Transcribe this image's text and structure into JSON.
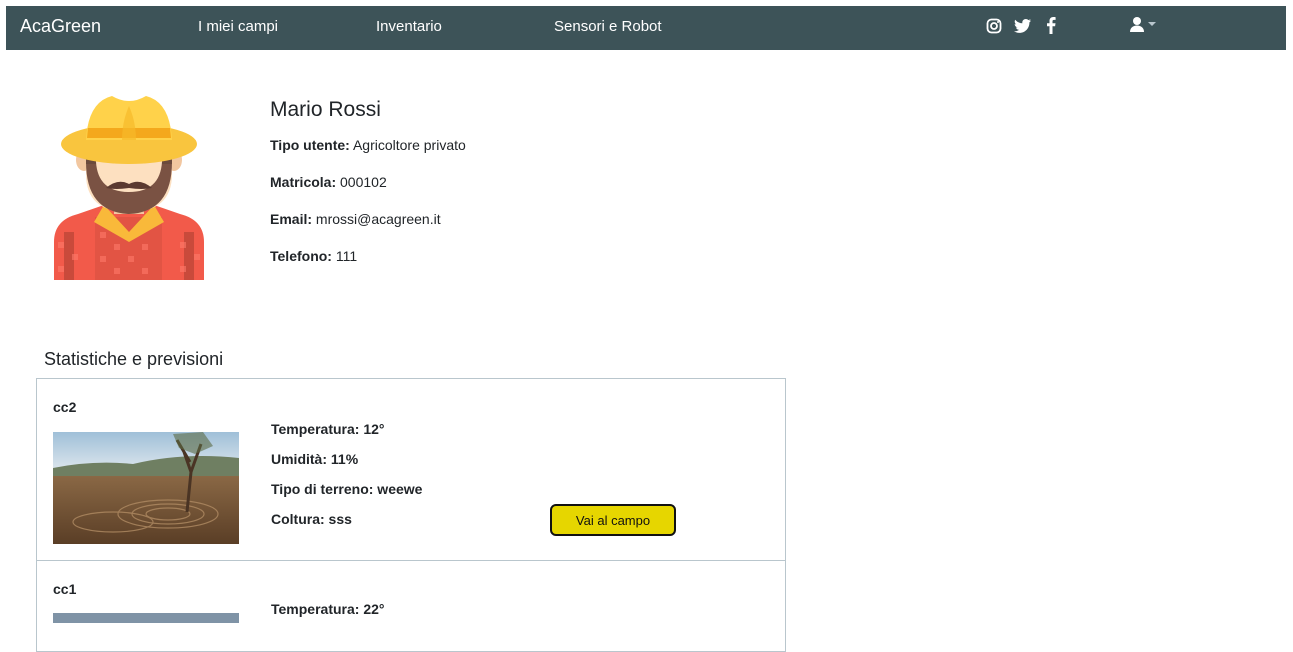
{
  "navbar": {
    "brand": "AcaGreen",
    "links": [
      "I miei campi",
      "Inventario",
      "Sensori e Robot"
    ],
    "social": [
      "instagram-icon",
      "twitter-icon",
      "facebook-icon"
    ],
    "user_menu": "user-icon"
  },
  "profile": {
    "name": "Mario Rossi",
    "fields": [
      {
        "label": "Tipo utente:",
        "value": " Agricoltore privato"
      },
      {
        "label": "Matricola:",
        "value": " 000102"
      },
      {
        "label": "Email:",
        "value": " mrossi@acagreen.it"
      },
      {
        "label": "Telefono:",
        "value": " 111"
      }
    ]
  },
  "stats": {
    "title": "Statistiche e previsioni",
    "fields": [
      {
        "name": "cc2",
        "lines": [
          "Temperatura: 12°",
          "Umidità: 11%",
          "Tipo di terreno: weewe",
          "Coltura: sss"
        ],
        "button": "Vai al campo"
      },
      {
        "name": "cc1",
        "lines": [
          "Temperatura: 22°"
        ]
      }
    ]
  }
}
